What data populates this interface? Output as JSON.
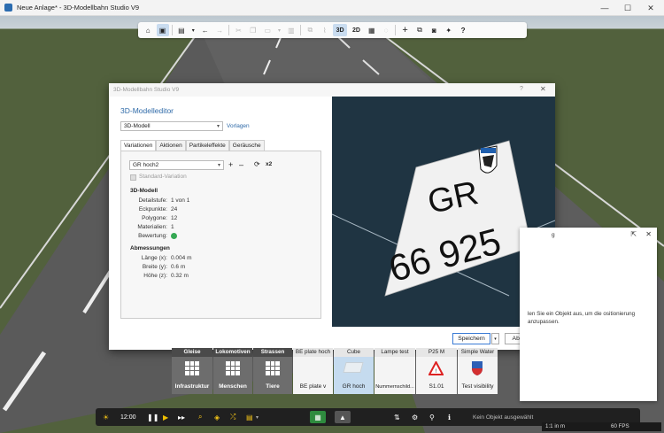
{
  "window": {
    "title": "Neue Anlage* - 3D-Modellbahn Studio V9",
    "minimize": "—",
    "maximize": "☐",
    "close": "✕"
  },
  "toolbar": {
    "items": [
      {
        "icon": "home-icon",
        "glyph": "⌂"
      },
      {
        "icon": "train-icon",
        "glyph": "▣"
      },
      {
        "icon": "save-icon",
        "glyph": "▤"
      },
      {
        "icon": "back-icon",
        "glyph": "←"
      },
      {
        "icon": "forward-icon",
        "glyph": "→"
      },
      {
        "icon": "cut-icon",
        "glyph": "✂"
      },
      {
        "icon": "copy-icon",
        "glyph": "❐"
      },
      {
        "icon": "delete-icon",
        "glyph": "🗑"
      },
      {
        "icon": "add-icon",
        "glyph": "+"
      },
      {
        "icon": "camera-icon",
        "glyph": "◉"
      },
      {
        "icon": "help-icon",
        "glyph": "?"
      }
    ],
    "mode_3d": "3D",
    "mode_2d": "2D"
  },
  "dialog": {
    "title": "3D-Modellbahn Studio V9",
    "help": "?",
    "close": "✕",
    "heading": "3D-Modelleditor",
    "model_select": "3D-Modell",
    "templates_link": "Vorlagen",
    "tabs": [
      "Variationen",
      "Aktionen",
      "Partikeleffekte",
      "Geräusche"
    ],
    "variation_select": "GR hoch2",
    "variation_add": "+",
    "variation_remove": "–",
    "variation_copy": "x2",
    "standard_variation": "Standard-Variation",
    "model_section": "3D-Modell",
    "model_rows": [
      {
        "label": "Detailstufe:",
        "value": "1 von 1"
      },
      {
        "label": "Eckpunkte:",
        "value": "24"
      },
      {
        "label": "Polygone:",
        "value": "12"
      },
      {
        "label": "Materialien:",
        "value": "1"
      },
      {
        "label": "Bewertung:",
        "value": ""
      }
    ],
    "dimensions_section": "Abmessungen",
    "dimension_rows": [
      {
        "label": "Länge (x):",
        "value": "0.004 m"
      },
      {
        "label": "Breite (y):",
        "value": "0.6 m"
      },
      {
        "label": "Höhe (z):",
        "value": "0.32 m"
      }
    ],
    "preview": {
      "plate_top": "GR",
      "plate_bottom": "66 925"
    },
    "save_button": "Speichern",
    "cancel_button": "Abbrechen"
  },
  "side_panel": {
    "partial_top": "g",
    "info_text": "len Sie ein Objekt aus, um die ositionierung anzupassen."
  },
  "catalog": {
    "categories": [
      {
        "head": "Gleise",
        "label": "Infrastruktur"
      },
      {
        "head": "Lokomotiven",
        "label": "Menschen"
      },
      {
        "head": "Strassen",
        "label": "Tiere"
      }
    ],
    "items": [
      {
        "head": "BE plate hoch",
        "label": "BE plate v"
      },
      {
        "head": "Cube",
        "label": "GR hoch"
      },
      {
        "head": "Lampe test",
        "label": "Nummernschild..."
      },
      {
        "head": "P25 M",
        "label": "S1.01"
      },
      {
        "head": "Simple Water",
        "label": "Test visibility"
      }
    ]
  },
  "bottombar": {
    "time": "12:00",
    "status": "Kein Objekt ausgewählt"
  },
  "statusbar": {
    "scale": "1:1 in m",
    "fps": "60 FPS"
  }
}
